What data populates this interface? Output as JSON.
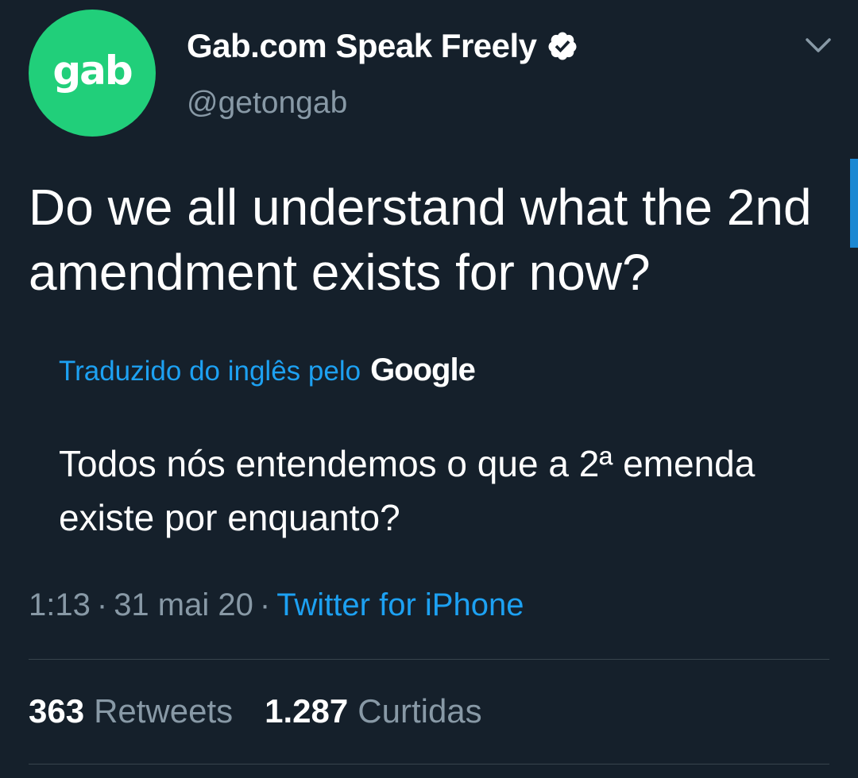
{
  "account": {
    "avatar_text": "gab",
    "display_name": "Gab.com Speak Freely",
    "handle": "@getongab",
    "verified": true
  },
  "tweet": {
    "text": "Do we all understand what the 2nd amendment exists for now?",
    "translation_label": "Traduzido do inglês pelo",
    "translation_provider": "Google",
    "translated_text": "Todos nós entendemos o que a 2ª emenda existe por enquanto?"
  },
  "meta": {
    "time": "1:13",
    "separator": "·",
    "date": "31 mai 20",
    "client": "Twitter for iPhone"
  },
  "stats": {
    "retweets_count": "363",
    "retweets_label": "Retweets",
    "likes_count": "1.287",
    "likes_label": "Curtidas"
  },
  "colors": {
    "background": "#15202b",
    "avatar": "#21cf7a",
    "link": "#1da1f2",
    "secondary_text": "#8899a6"
  },
  "icons": {
    "verified": "verified-badge-icon",
    "menu": "chevron-down-icon"
  }
}
